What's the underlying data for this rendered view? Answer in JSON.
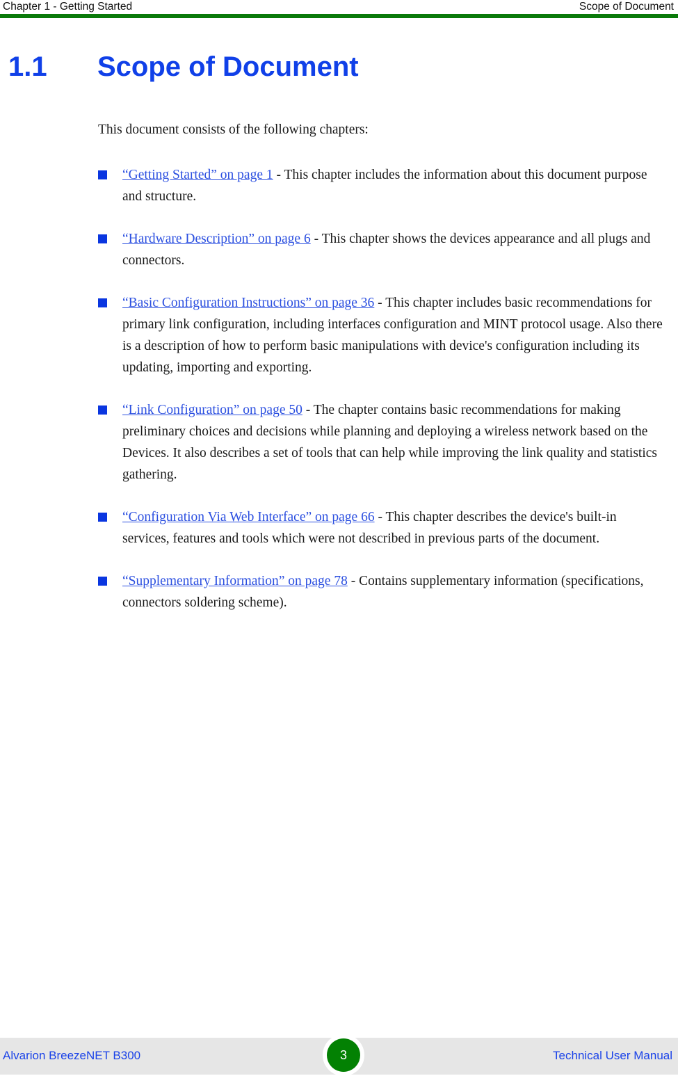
{
  "header": {
    "left": "Chapter 1 - Getting Started",
    "right": "Scope of Document",
    "rule_color": "#0a7a0a"
  },
  "section": {
    "number": "1.1",
    "title": "Scope of Document",
    "color": "#1040e8"
  },
  "body": {
    "intro": "This document consists of the following chapters:",
    "bullet_glyph": "filled-square",
    "bullet_color": "#0a36e0",
    "link_color": "#2b4fe0",
    "items": [
      {
        "link": "“Getting Started” on page 1",
        "rest": " - This chapter includes the information about this document purpose and structure."
      },
      {
        "link": "“Hardware Description” on page 6",
        "rest": " - This chapter shows the devices appearance and all plugs and connectors."
      },
      {
        "link": "“Basic Configuration Instructions” on page 36",
        "rest": " - This chapter includes basic recommendations for primary link configuration, including interfaces configuration and MINT protocol usage. Also there is a description of how to perform basic manipulations with device's configuration including its updating, importing and exporting."
      },
      {
        "link": "“Link Configuration” on page 50",
        "rest": " - The chapter contains basic recommendations for making preliminary choices and decisions while planning and deploying a wireless network based on the Devices. It also describes a set of tools that can help while improving the link quality and statistics gathering."
      },
      {
        "link": "“Configuration Via Web Interface” on page 66",
        "rest": " - This chapter describes the device's built-in services, features and tools which were not described in previous parts of the document."
      },
      {
        "link": "“Supplementary Information” on page 78",
        "rest": " - Contains supplementary information (specifications, connectors soldering scheme)."
      }
    ]
  },
  "footer": {
    "left": "Alvarion BreezeNET B300",
    "right": "Technical User Manual",
    "page_number": "3",
    "badge_color": "#038103",
    "background": "#e6e6e6",
    "text_color": "#1b43e8"
  }
}
